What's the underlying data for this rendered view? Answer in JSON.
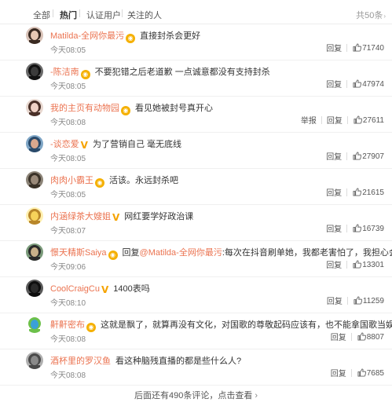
{
  "tabs": [
    {
      "label": "全部"
    },
    {
      "label": "热门",
      "active": true
    },
    {
      "label": "认证用户"
    },
    {
      "label": "关注的人"
    }
  ],
  "total_label": "共50条",
  "reply_label": "回复",
  "report_label": "举报",
  "comments": [
    {
      "user": "Matilda-全网你最污",
      "badge": "vip",
      "text": "直接封杀会更好",
      "time": "今天08:05",
      "likes": "71740",
      "show_report": false,
      "avatar": {
        "skin": "#e8c8b4",
        "hair": "#3a2a22",
        "bg": "#d9c3b8"
      }
    },
    {
      "user": "-陈洁南",
      "badge": "vip",
      "text": "不要犯错之后老道歉 一点诚意都没有支持封杀",
      "time": "今天08:05",
      "likes": "47974",
      "show_report": false,
      "avatar": {
        "skin": "#3b3b3b",
        "hair": "#111111",
        "bg": "#6a6a6a"
      }
    },
    {
      "user": "我的主页有动物园",
      "badge": "vip",
      "text": "看见她被封号真开心",
      "time": "今天08:08",
      "likes": "27611",
      "show_report": true,
      "avatar": {
        "skin": "#f0d2c6",
        "hair": "#4a3028",
        "bg": "#e8d8d0"
      }
    },
    {
      "user": "-谈恋爱",
      "badge": "v",
      "text": "为了营销自己 毫无底线",
      "time": "今天08:05",
      "likes": "27907",
      "show_report": false,
      "avatar": {
        "skin": "#d9a88e",
        "hair": "#2a4a6a",
        "bg": "#7fa6c6"
      }
    },
    {
      "user": "肉肉小霸王",
      "badge": "vip",
      "text": "活该。永远封杀吧",
      "time": "今天08:05",
      "likes": "21615",
      "show_report": false,
      "avatar": {
        "skin": "#9a8a7a",
        "hair": "#3a3228",
        "bg": "#8c8478"
      }
    },
    {
      "user": "内涵绿茶大嫂姐",
      "badge": "v",
      "text": "网红要学好政治课",
      "time": "今天08:07",
      "likes": "16739",
      "show_report": false,
      "avatar": {
        "skin": "#f7d25a",
        "hair": "#b8862a",
        "bg": "#fff0b0"
      }
    },
    {
      "user": "憬天精斯Saiya",
      "badge": "vip",
      "text_before": "回复",
      "mention": "@Matilda-全网你最污",
      "text": ":每次在抖音刷单她，我都老害怕了，我担心会自动扣赛",
      "emoji": true,
      "time": "今天09:06",
      "likes": "13301",
      "show_report": false,
      "avatar": {
        "skin": "#c8b08a",
        "hair": "#2a2a2a",
        "bg": "#7a9a7a"
      }
    },
    {
      "user": "CoolCraigCu",
      "badge": "v",
      "text": "1400表吗",
      "time": "今天08:10",
      "likes": "11259",
      "show_report": false,
      "avatar": {
        "skin": "#2a2a2a",
        "hair": "#0e0e0e",
        "bg": "#5a5a5a"
      }
    },
    {
      "user": "鼾鼾密布",
      "badge": "vip",
      "text": "这就是飘了，就算再没有文化，对国歌的尊敬起码应该有，也不能拿国歌当娱乐啊",
      "time": "今天08:08",
      "likes": "8807",
      "show_report": false,
      "avatar": {
        "skin": "#3aa0d8",
        "hair": "#6cc04a",
        "bg": "#ffffff"
      }
    },
    {
      "user": "酒杯里的罗汉鱼",
      "badge": "none",
      "text": "看这种脑残直播的都是些什么人?",
      "time": "今天08:08",
      "likes": "7685",
      "show_report": false,
      "avatar": {
        "skin": "#8a8a8a",
        "hair": "#4a4a4a",
        "bg": "#b0b0b0"
      }
    }
  ],
  "more_label": "后面还有490条评论，点击查看",
  "colors": {
    "accent": "#eb7350",
    "badge": "#f5b000"
  }
}
